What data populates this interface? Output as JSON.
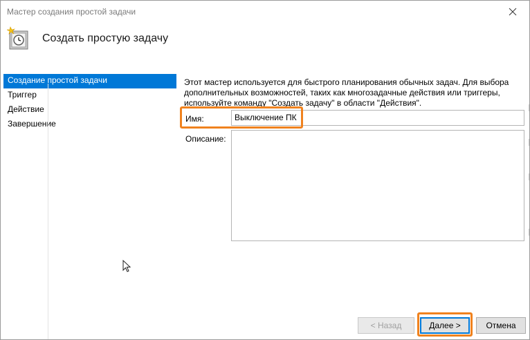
{
  "window": {
    "title": "Мастер создания простой задачи",
    "close_glyph": "✕"
  },
  "header": {
    "title": "Создать простую задачу",
    "icon": "task-scheduler-clock-icon"
  },
  "sidebar": {
    "items": [
      {
        "label": "Создание простой задачи",
        "active": true
      },
      {
        "label": "Триггер",
        "active": false
      },
      {
        "label": "Действие",
        "active": false
      },
      {
        "label": "Завершение",
        "active": false
      }
    ]
  },
  "main": {
    "description": "Этот мастер используется для быстрого планирования обычных задач.  Для выбора дополнительных возможностей, таких как многозадачные действия или триггеры, используйте команду \"Создать задачу\" в области \"Действия\".",
    "name_label": "Имя:",
    "name_value": "Выключение ПК",
    "description_label": "Описание:",
    "description_value": ""
  },
  "buttons": {
    "back": "< Назад",
    "next": "Далее >",
    "cancel": "Отмена"
  },
  "colors": {
    "selection": "#0078d7",
    "highlight": "#f0821e"
  }
}
